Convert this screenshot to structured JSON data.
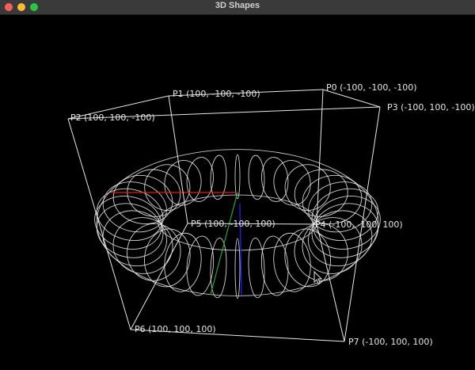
{
  "window": {
    "title": "3D Shapes",
    "controls": [
      "close",
      "minimize",
      "maximize"
    ]
  },
  "colors": {
    "background": "#000000",
    "wireframe": "#e8e8e8",
    "axis_x": "#e01b1b",
    "axis_y": "#22a83a",
    "axis_z": "#1a1ad8"
  },
  "scene": {
    "shape": "torus",
    "vertices": [
      {
        "id": "P0",
        "label": "P0 (-100, -100, -100)"
      },
      {
        "id": "P1",
        "label": "P1 (100, -100, -100)"
      },
      {
        "id": "P2",
        "label": "P2 (100, 100, -100)"
      },
      {
        "id": "P3",
        "label": "P3 (-100, 100, -100)"
      },
      {
        "id": "P4",
        "label": "P4 (-100, -100, 100)"
      },
      {
        "id": "P5",
        "label": "P5 (100, -100, 100)"
      },
      {
        "id": "P6",
        "label": "P6 (100, 100, 100)"
      },
      {
        "id": "P7",
        "label": "P7 (-100, 100, 100)"
      }
    ],
    "edges": [
      [
        0,
        1
      ],
      [
        1,
        2
      ],
      [
        2,
        3
      ],
      [
        3,
        0
      ],
      [
        4,
        5
      ],
      [
        5,
        6
      ],
      [
        6,
        7
      ],
      [
        7,
        4
      ],
      [
        0,
        4
      ],
      [
        1,
        5
      ],
      [
        2,
        6
      ],
      [
        3,
        7
      ]
    ],
    "cursor": "arrow-pointer"
  }
}
